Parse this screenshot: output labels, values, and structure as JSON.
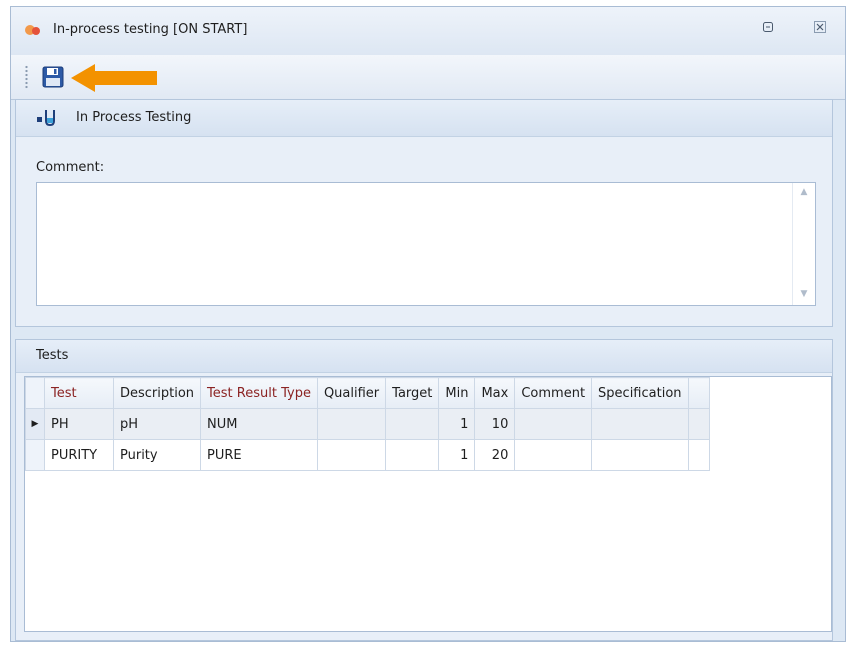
{
  "window": {
    "title": "In-process testing [ON START]",
    "restore_glyph": "▫",
    "close_glyph": "✕"
  },
  "toolbar": {
    "save_icon": "floppy-disk-icon",
    "highlight_color": "#f39200"
  },
  "process_panel": {
    "title": "In Process Testing",
    "comment_label": "Comment:",
    "comment_value": ""
  },
  "tests_panel": {
    "title": "Tests",
    "columns": [
      "Test",
      "Description",
      "Test Result Type",
      "Qualifier",
      "Target",
      "Min",
      "Max",
      "Comment",
      "Specification"
    ],
    "required_columns": [
      "Test",
      "Test Result Type"
    ],
    "rows": [
      {
        "test": "PH",
        "description": "pH",
        "result_type": "NUM",
        "qualifier": "",
        "target": "",
        "min": "1",
        "max": "10",
        "comment": "",
        "specification": "",
        "selected": true
      },
      {
        "test": "PURITY",
        "description": "Purity",
        "result_type": "PURE",
        "qualifier": "",
        "target": "",
        "min": "1",
        "max": "20",
        "comment": "",
        "specification": "",
        "selected": false
      }
    ]
  },
  "colors": {
    "required_header": "#8b2323",
    "panel_bg": "#e8eff8",
    "accent_arrow": "#f39200"
  }
}
